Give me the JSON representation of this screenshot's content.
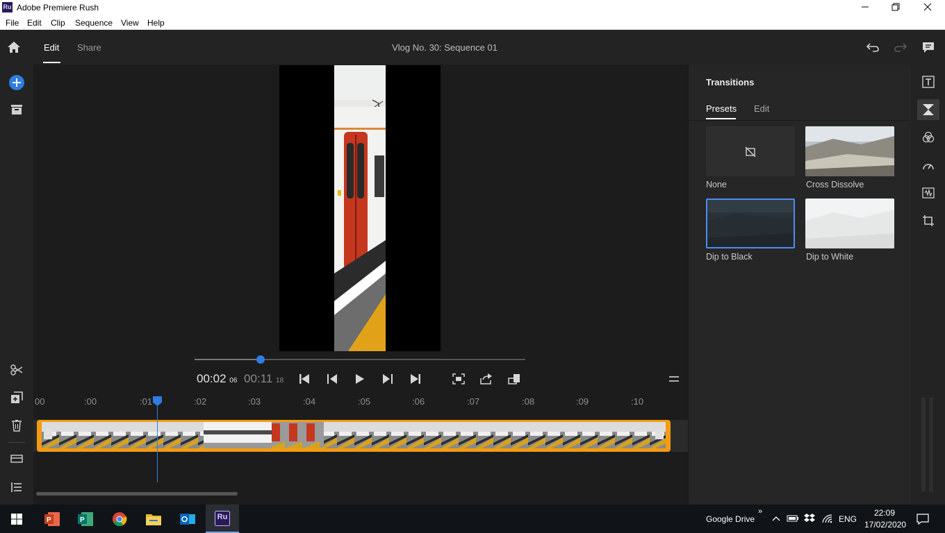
{
  "window": {
    "icon_text": "Ru",
    "title": "Adobe Premiere Rush"
  },
  "menu": [
    "File",
    "Edit",
    "Clip",
    "Sequence",
    "View",
    "Help"
  ],
  "header": {
    "tabs": [
      {
        "label": "Edit",
        "active": true
      },
      {
        "label": "Share",
        "active": false
      }
    ],
    "sequence_title": "Vlog No. 30: Sequence 01"
  },
  "player": {
    "current_time": "00:02",
    "current_frames": "06",
    "total_time": "00:11",
    "total_frames": "18",
    "progress": 0.2
  },
  "timeline": {
    "ruler_labels": [
      "00",
      ":00",
      ":01",
      ":02",
      ":03",
      ":04",
      ":05",
      ":06",
      ":07",
      ":08",
      ":09",
      ":10"
    ]
  },
  "panel": {
    "title": "Transitions",
    "tabs": [
      {
        "label": "Presets",
        "active": true
      },
      {
        "label": "Edit",
        "active": false
      }
    ],
    "presets": [
      {
        "label": "None",
        "selected": false
      },
      {
        "label": "Cross Dissolve",
        "selected": false
      },
      {
        "label": "Dip to Black",
        "selected": true
      },
      {
        "label": "Dip to White",
        "selected": false
      }
    ]
  },
  "taskbar": {
    "apps": [
      "powerpoint-icon",
      "publisher-icon",
      "chrome-icon",
      "file-explorer-icon",
      "outlook-icon",
      "premiere-rush-icon"
    ],
    "tray_label": "Google Drive",
    "language": "ENG",
    "time": "22:09",
    "date": "17/02/2020",
    "rush_icon_text": "Ru"
  },
  "colors": {
    "accent": "#2f7de1",
    "clip_border": "#f39c12",
    "background": "#232323"
  }
}
